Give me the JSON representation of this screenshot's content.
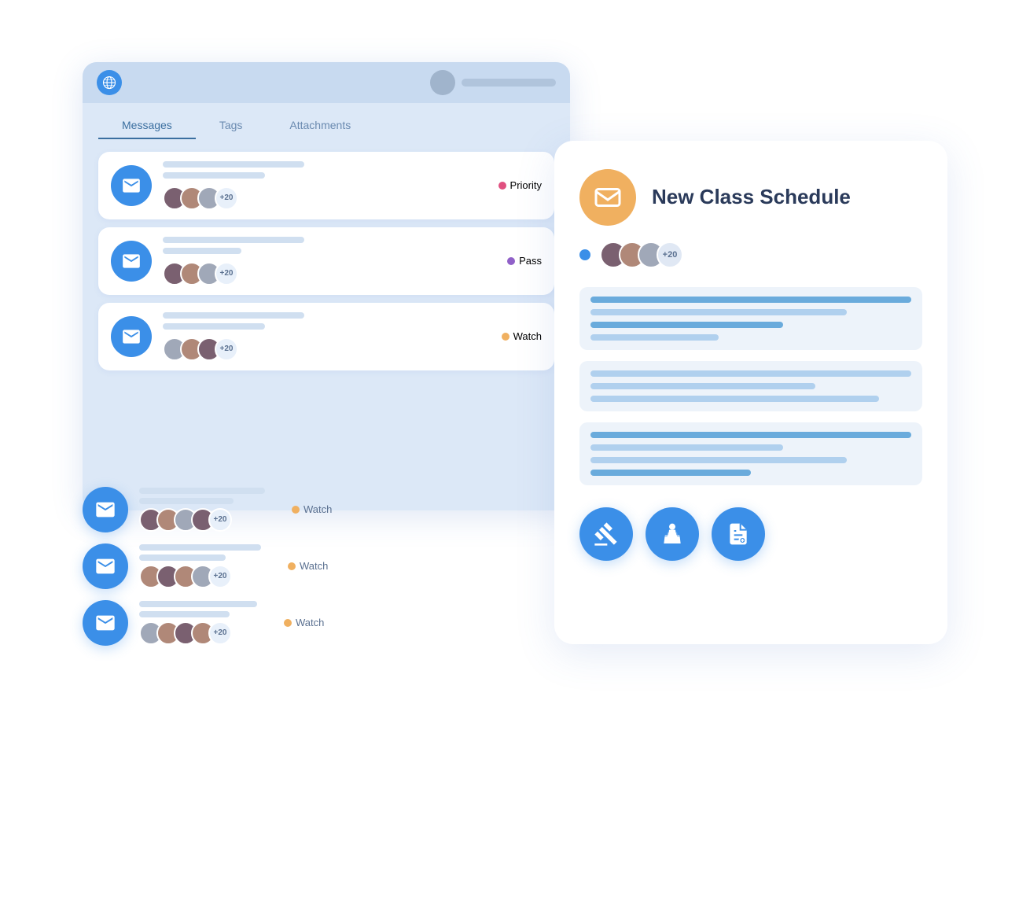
{
  "app": {
    "titlebar": {
      "globe_icon": "🌐",
      "avatar_placeholder": "",
      "bar_placeholder": ""
    },
    "tabs": [
      {
        "label": "Messages",
        "active": true
      },
      {
        "label": "Tags",
        "active": false
      },
      {
        "label": "Attachments",
        "active": false
      }
    ],
    "messages": [
      {
        "tag_label": "Priority",
        "tag_color": "#e05080",
        "avatar_count": "+20"
      },
      {
        "tag_label": "Pass",
        "tag_color": "#9060c8",
        "avatar_count": "+20"
      },
      {
        "tag_label": "Watch",
        "tag_color": "#f0b060",
        "avatar_count": "+20"
      }
    ],
    "floating_messages": [
      {
        "tag_label": "Watch",
        "tag_color": "#f0b060",
        "avatar_count": "+20"
      },
      {
        "tag_label": "Watch",
        "tag_color": "#f0b060",
        "avatar_count": "+20"
      },
      {
        "tag_label": "Watch",
        "tag_color": "#f0b060",
        "avatar_count": "+20"
      }
    ]
  },
  "detail": {
    "title": "New Class Schedule",
    "icon_label": "envelope",
    "avatar_count": "+20",
    "action_buttons": [
      {
        "icon": "gavel",
        "label": "gavel-icon"
      },
      {
        "icon": "podium",
        "label": "podium-icon"
      },
      {
        "icon": "document",
        "label": "document-icon"
      }
    ]
  }
}
